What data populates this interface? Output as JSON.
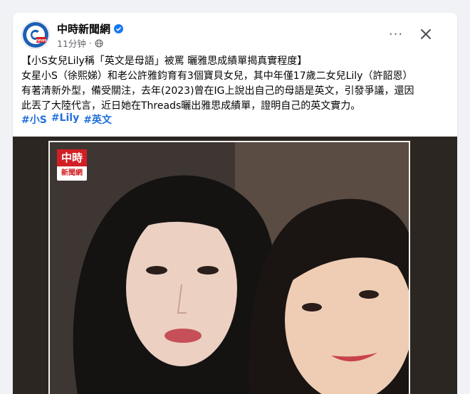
{
  "post": {
    "page_name": "中時新聞網",
    "timestamp": "11分钟",
    "privacy_icon": "globe-icon",
    "verified_icon": "verified-badge-icon",
    "more_label": "···",
    "text_lines": [
      "【小S女兒Lily稱「英文是母語」被罵 曬雅思成績單揭真實程度】",
      "女星小S（徐熙娣）和老公許雅鈞育有3個寶貝女兒，其中年僅17歲二女兒Lily（許韶恩）",
      "有著清新外型，備受關注，去年(2023)曾在IG上說出自己的母語是英文，引發爭議，還因",
      "此丟了大陸代言，近日她在Threads曬出雅思成績單，證明自己的英文實力。"
    ],
    "hashtags": [
      "#小S",
      "#Lily",
      "#英文"
    ]
  },
  "media": {
    "watermark_top": "中時",
    "watermark_bottom": "新聞網"
  },
  "colors": {
    "link": "#216fdb",
    "brand_red": "#d21f26",
    "brand_blue": "#1d5fb3"
  }
}
